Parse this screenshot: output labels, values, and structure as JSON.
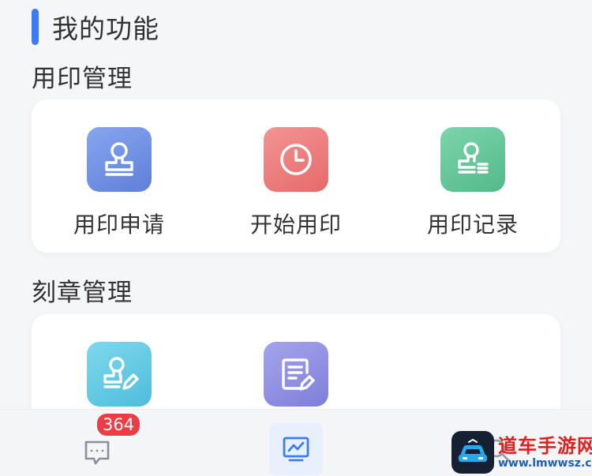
{
  "header": {
    "title": "我的功能"
  },
  "sections": [
    {
      "title": "用印管理",
      "items": [
        {
          "label": "用印申请",
          "icon": "seal-stamp-icon",
          "color": "#6f8fe2"
        },
        {
          "label": "开始用印",
          "icon": "clock-icon",
          "color": "#ec7a79"
        },
        {
          "label": "用印记录",
          "icon": "seal-record-icon",
          "color": "#64c59b"
        }
      ]
    },
    {
      "title": "刻章管理",
      "items": [
        {
          "label": "",
          "icon": "seal-edit-icon",
          "color": "#62c9e3"
        },
        {
          "label": "",
          "icon": "document-edit-icon",
          "color": "#8f8ee0"
        }
      ]
    }
  ],
  "bottom_nav": {
    "tabs": [
      {
        "name": "messages",
        "icon": "chat-icon"
      },
      {
        "name": "statistics",
        "icon": "chart-icon",
        "active": true
      },
      {
        "name": "search",
        "icon": "search-icon"
      }
    ],
    "message_badge": "364"
  },
  "watermark": {
    "text": "道车手游网",
    "url": "www.lmwwsz.com"
  },
  "colors": {
    "accent": "#3b7cf5",
    "badge": "#ee3c45"
  }
}
